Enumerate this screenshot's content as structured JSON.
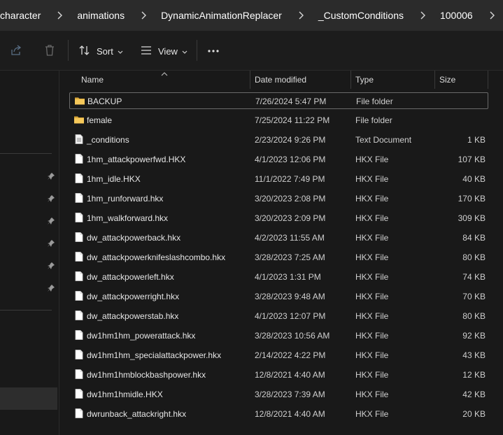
{
  "breadcrumb": [
    "character",
    "animations",
    "DynamicAnimationReplacer",
    "_CustomConditions",
    "100006"
  ],
  "toolbar": {
    "sort_label": "Sort",
    "view_label": "View",
    "more_label": "…"
  },
  "columns": {
    "name": "Name",
    "date": "Date modified",
    "type": "Type",
    "size": "Size"
  },
  "files": [
    {
      "name": "BACKUP",
      "date": "7/26/2024 5:47 PM",
      "type": "File folder",
      "size": "",
      "kind": "folder-icon"
    },
    {
      "name": "female",
      "date": "7/25/2024 11:22 PM",
      "type": "File folder",
      "size": "",
      "kind": "folder-icon"
    },
    {
      "name": "_conditions",
      "date": "2/23/2024 9:26 PM",
      "type": "Text Document",
      "size": "1 KB",
      "kind": "text-document-icon"
    },
    {
      "name": "1hm_attackpowerfwd.HKX",
      "date": "4/1/2023 12:06 PM",
      "type": "HKX File",
      "size": "107 KB",
      "kind": "file-icon"
    },
    {
      "name": "1hm_idle.HKX",
      "date": "11/1/2022 7:49 PM",
      "type": "HKX File",
      "size": "40 KB",
      "kind": "file-icon"
    },
    {
      "name": "1hm_runforward.hkx",
      "date": "3/20/2023 2:08 PM",
      "type": "HKX File",
      "size": "170 KB",
      "kind": "file-icon"
    },
    {
      "name": "1hm_walkforward.hkx",
      "date": "3/20/2023 2:09 PM",
      "type": "HKX File",
      "size": "309 KB",
      "kind": "file-icon"
    },
    {
      "name": "dw_attackpowerback.hkx",
      "date": "4/2/2023 11:55 AM",
      "type": "HKX File",
      "size": "84 KB",
      "kind": "file-icon"
    },
    {
      "name": "dw_attackpowerknifeslashcombo.hkx",
      "date": "3/28/2023 7:25 AM",
      "type": "HKX File",
      "size": "80 KB",
      "kind": "file-icon"
    },
    {
      "name": "dw_attackpowerleft.hkx",
      "date": "4/1/2023 1:31 PM",
      "type": "HKX File",
      "size": "74 KB",
      "kind": "file-icon"
    },
    {
      "name": "dw_attackpowerright.hkx",
      "date": "3/28/2023 9:48 AM",
      "type": "HKX File",
      "size": "70 KB",
      "kind": "file-icon"
    },
    {
      "name": "dw_attackpowerstab.hkx",
      "date": "4/1/2023 12:07 PM",
      "type": "HKX File",
      "size": "80 KB",
      "kind": "file-icon"
    },
    {
      "name": "dw1hm1hm_powerattack.hkx",
      "date": "3/28/2023 10:56 AM",
      "type": "HKX File",
      "size": "92 KB",
      "kind": "file-icon"
    },
    {
      "name": "dw1hm1hm_specialattackpower.hkx",
      "date": "2/14/2022 4:22 PM",
      "type": "HKX File",
      "size": "43 KB",
      "kind": "file-icon"
    },
    {
      "name": "dw1hm1hmblockbashpower.hkx",
      "date": "12/8/2021 4:40 AM",
      "type": "HKX File",
      "size": "12 KB",
      "kind": "file-icon"
    },
    {
      "name": "dw1hm1hmidle.HKX",
      "date": "3/28/2023 7:39 AM",
      "type": "HKX File",
      "size": "42 KB",
      "kind": "file-icon"
    },
    {
      "name": "dwrunback_attackright.hkx",
      "date": "12/8/2021 4:40 AM",
      "type": "HKX File",
      "size": "20 KB",
      "kind": "file-icon"
    }
  ],
  "colors": {
    "folder": "#f4c64a",
    "background": "#191919",
    "breadcrumb_bg": "#2b2b2b"
  }
}
